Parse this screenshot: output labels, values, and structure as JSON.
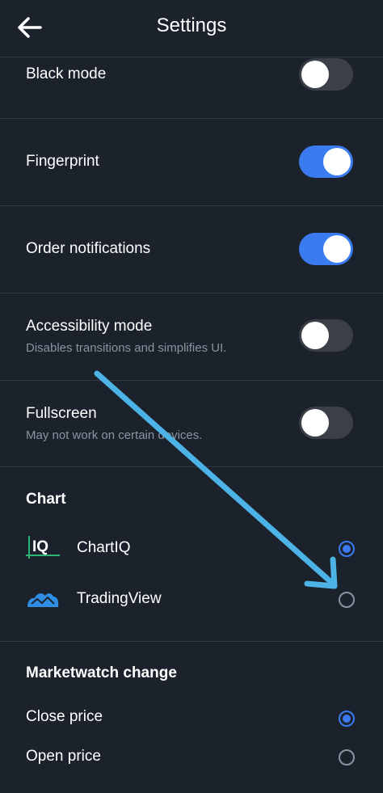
{
  "header": {
    "title": "Settings"
  },
  "toggles": [
    {
      "label": "Black mode",
      "enabled": false
    },
    {
      "label": "Fingerprint",
      "enabled": true
    },
    {
      "label": "Order notifications",
      "enabled": true
    },
    {
      "label": "Accessibility mode",
      "subtitle": "Disables transitions and simplifies UI.",
      "enabled": false
    },
    {
      "label": "Fullscreen",
      "subtitle": "May not work on certain devices.",
      "enabled": false
    }
  ],
  "chart": {
    "title": "Chart",
    "options": [
      {
        "label": "ChartIQ",
        "icon": "chartiq-logo-icon",
        "selected": true
      },
      {
        "label": "TradingView",
        "icon": "tradingview-logo-icon",
        "selected": false
      }
    ]
  },
  "marketwatch": {
    "title": "Marketwatch change",
    "options": [
      {
        "label": "Close price",
        "selected": true
      },
      {
        "label": "Open price",
        "selected": false
      }
    ]
  },
  "colors": {
    "background": "#1b222c",
    "accent": "#3a7cf0",
    "toggle_off": "#3b4048",
    "annotation_arrow": "#4db3e6"
  }
}
